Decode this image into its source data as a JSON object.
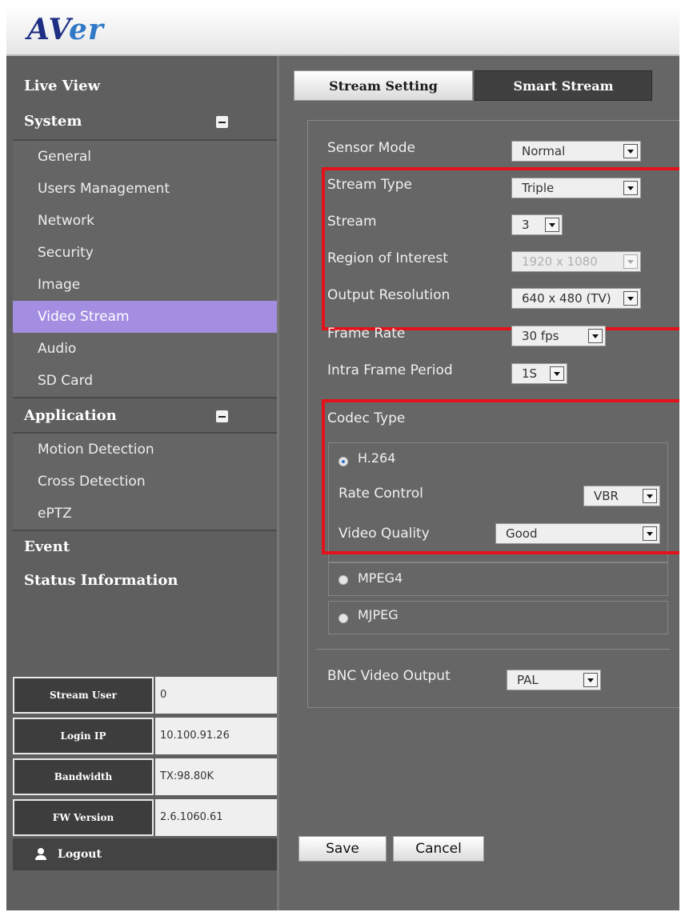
{
  "header": {
    "logo_main": "AV",
    "logo_accent": "er"
  },
  "sidebar": {
    "live_view": "Live View",
    "system": "System",
    "system_items": [
      "General",
      "Users Management",
      "Network",
      "Security",
      "Image",
      "Video Stream",
      "Audio",
      "SD Card"
    ],
    "application": "Application",
    "application_items": [
      "Motion Detection",
      "Cross Detection",
      "ePTZ"
    ],
    "event": "Event",
    "status_information": "Status Information",
    "active_item": "Video Stream"
  },
  "status": {
    "rows": [
      {
        "label": "Stream User",
        "value": "0"
      },
      {
        "label": "Login IP",
        "value": "10.100.91.26"
      },
      {
        "label": "Bandwidth",
        "value": "TX:98.80K"
      },
      {
        "label": "FW Version",
        "value": "2.6.1060.61"
      }
    ],
    "logout_label": "Logout"
  },
  "tabs": {
    "stream_setting": "Stream Setting",
    "smart_stream": "Smart Stream",
    "active": "Stream Setting"
  },
  "form": {
    "sensor_mode": {
      "label": "Sensor Mode",
      "value": "Normal"
    },
    "stream_type": {
      "label": "Stream Type",
      "value": "Triple"
    },
    "stream": {
      "label": "Stream",
      "value": "3"
    },
    "region_of_interest": {
      "label": "Region of Interest",
      "value": "1920 x 1080"
    },
    "output_resolution": {
      "label": "Output Resolution",
      "value": "640 x 480 (TV)"
    },
    "frame_rate": {
      "label": "Frame Rate",
      "value": "30 fps"
    },
    "intra_frame_period": {
      "label": "Intra Frame Period",
      "value": "1S"
    },
    "codec_type": {
      "label": "Codec Type",
      "selected": "H.264",
      "h264": "H.264",
      "rate_control": {
        "label": "Rate Control",
        "value": "VBR"
      },
      "video_quality": {
        "label": "Video Quality",
        "value": "Good"
      },
      "mpeg4": "MPEG4",
      "mjpeg": "MJPEG"
    },
    "bnc_video_output": {
      "label": "BNC Video Output",
      "value": "PAL"
    }
  },
  "buttons": {
    "save": "Save",
    "cancel": "Cancel"
  },
  "colors": {
    "highlight_box": "#e3121b",
    "active_nav": "#a38ee2",
    "logo_blue": "#1d2e84"
  }
}
